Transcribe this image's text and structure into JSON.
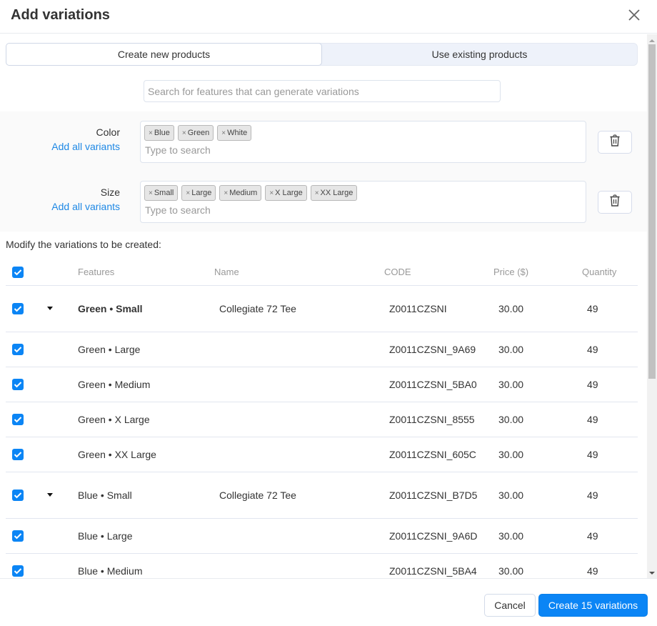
{
  "dialog": {
    "title": "Add variations",
    "close_icon": "close-icon"
  },
  "tabs": [
    {
      "label": "Create new products",
      "active": true
    },
    {
      "label": "Use existing products",
      "active": false
    }
  ],
  "feature_search": {
    "placeholder": "Search for features that can generate variations",
    "value": ""
  },
  "features": [
    {
      "name": "Color",
      "add_all_label": "Add all variants",
      "tags": [
        "Blue",
        "Green",
        "White"
      ],
      "input_placeholder": "Type to search",
      "delete_icon": "trash-icon"
    },
    {
      "name": "Size",
      "add_all_label": "Add all variants",
      "tags": [
        "Small",
        "Large",
        "Medium",
        "X Large",
        "XX Large"
      ],
      "input_placeholder": "Type to search",
      "delete_icon": "trash-icon"
    }
  ],
  "tag_remove_glyph": "×",
  "modify_label": "Modify the variations to be created:",
  "table": {
    "select_all_checked": true,
    "columns": [
      "Features",
      "Name",
      "CODE",
      "Price ($)",
      "Quantity"
    ],
    "rows": [
      {
        "type": "parent",
        "checked": true,
        "expanded": true,
        "bold": true,
        "features": "Green • Small",
        "name": "Collegiate 72 Tee",
        "code": "Z0011CZSNI",
        "price": "30.00",
        "quantity": "49"
      },
      {
        "type": "child",
        "checked": true,
        "features": "Green • Large",
        "name": "",
        "code": "Z0011CZSNI_9A69",
        "price": "30.00",
        "quantity": "49"
      },
      {
        "type": "child",
        "checked": true,
        "features": "Green • Medium",
        "name": "",
        "code": "Z0011CZSNI_5BA0",
        "price": "30.00",
        "quantity": "49"
      },
      {
        "type": "child",
        "checked": true,
        "features": "Green • X Large",
        "name": "",
        "code": "Z0011CZSNI_8555",
        "price": "30.00",
        "quantity": "49"
      },
      {
        "type": "child",
        "checked": true,
        "features": "Green • XX Large",
        "name": "",
        "code": "Z0011CZSNI_605C",
        "price": "30.00",
        "quantity": "49"
      },
      {
        "type": "parent",
        "checked": true,
        "expanded": true,
        "bold": false,
        "features": "Blue • Small",
        "name": "Collegiate 72 Tee",
        "code": "Z0011CZSNI_B7D5",
        "price": "30.00",
        "quantity": "49"
      },
      {
        "type": "child",
        "checked": true,
        "features": "Blue • Large",
        "name": "",
        "code": "Z0011CZSNI_9A6D",
        "price": "30.00",
        "quantity": "49"
      },
      {
        "type": "child",
        "checked": true,
        "features": "Blue • Medium",
        "name": "",
        "code": "Z0011CZSNI_5BA4",
        "price": "30.00",
        "quantity": "49"
      }
    ]
  },
  "footer": {
    "cancel_label": "Cancel",
    "create_label": "Create 15 variations"
  },
  "colors": {
    "accent": "#0b85f5",
    "link": "#1e88e5",
    "text": "#333333",
    "muted": "#999999"
  }
}
